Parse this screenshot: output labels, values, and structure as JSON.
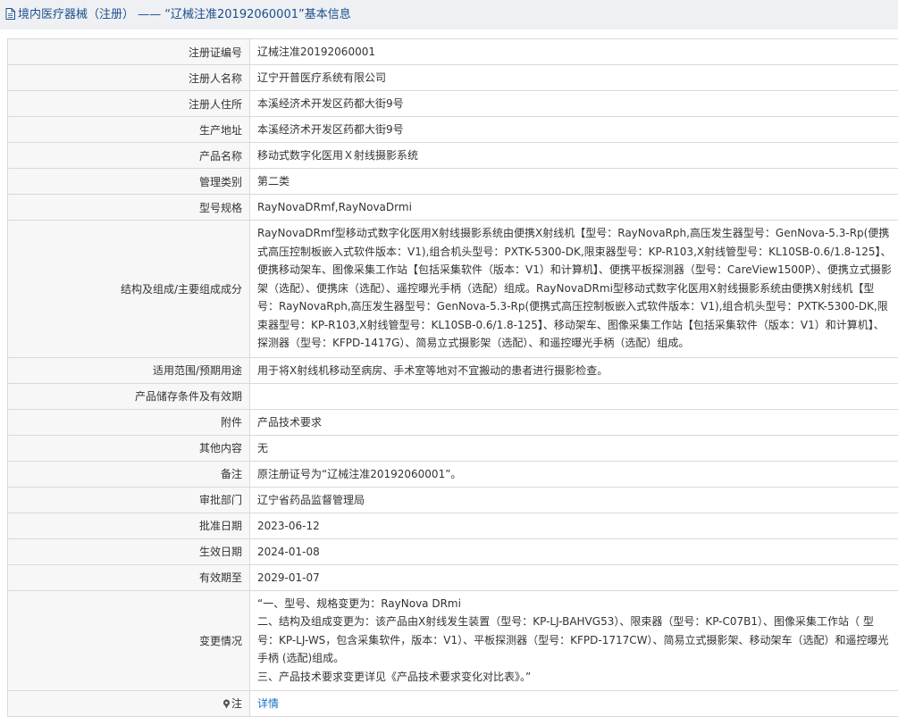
{
  "page": {
    "title": "境内医疗器械（注册） —— “辽械注准20192060001”基本信息"
  },
  "rows": [
    {
      "label": "注册证编号",
      "value": "辽械注准20192060001"
    },
    {
      "label": "注册人名称",
      "value": "辽宁开普医疗系统有限公司"
    },
    {
      "label": "注册人住所",
      "value": "本溪经济术开发区药都大街9号"
    },
    {
      "label": "生产地址",
      "value": "本溪经济术开发区药都大街9号"
    },
    {
      "label": "产品名称",
      "value": "移动式数字化医用Ｘ射线摄影系统"
    },
    {
      "label": "管理类别",
      "value": "第二类"
    },
    {
      "label": "型号规格",
      "value": "RayNovaDRmf,RayNovaDrmi"
    },
    {
      "label": "结构及组成/主要组成成分",
      "value": "RayNovaDRmf型移动式数字化医用X射线摄影系统由便携X射线机【型号：RayNovaRph,高压发生器型号：GenNova-5.3-Rp(便携式高压控制板嵌入式软件版本：V1),组合机头型号：PXTK-5300-DK,限束器型号：KP-R103,X射线管型号：KL10SB-0.6/1.8-125】、便携移动架车、图像采集工作站【包括采集软件（版本：V1）和计算机】、便携平板探测器（型号：CareView1500P）、便携立式摄影架（选配）、便携床（选配）、遥控曝光手柄（选配）组成。RayNovaDRmi型移动式数字化医用X射线摄影系统由便携X射线机【型号：RayNovaRph,高压发生器型号：GenNova-5.3-Rp(便携式高压控制板嵌入式软件版本：V1),组合机头型号：PXTK-5300-DK,限束器型号：KP-R103,X射线管型号：KL10SB-0.6/1.8-125】、移动架车、图像采集工作站【包括采集软件（版本：V1）和计算机】、探测器（型号：KFPD-1417G）、简易立式摄影架（选配）、和遥控曝光手柄（选配）组成。"
    },
    {
      "label": "适用范围/预期用途",
      "value": "用于将X射线机移动至病房、手术室等地对不宜搬动的患者进行摄影检查。"
    },
    {
      "label": "产品储存条件及有效期",
      "value": ""
    },
    {
      "label": "附件",
      "value": "产品技术要求"
    },
    {
      "label": "其他内容",
      "value": "无"
    },
    {
      "label": "备注",
      "value": "原注册证号为“辽械注准20192060001”。"
    },
    {
      "label": "审批部门",
      "value": "辽宁省药品监督管理局"
    },
    {
      "label": "批准日期",
      "value": "2023-06-12"
    },
    {
      "label": "生效日期",
      "value": "2024-01-08"
    },
    {
      "label": "有效期至",
      "value": "2029-01-07"
    }
  ],
  "change": {
    "label": "变更情况",
    "lines": [
      "“一、型号、规格变更为：RayNova DRmi",
      "二、结构及组成变更为：该产品由X射线发生装置（型号：KP-LJ-BAHVG53）、限束器（型号：KP-C07B1）、图像采集工作站（ 型号：KP-LJ-WS，包含采集软件，版本：V1）、平板探测器（型号：KFPD-1717CW）、简易立式摄影架、移动架车（选配）和遥控曝光手柄 (选配)组成。",
      "三、产品技术要求变更详见《产品技术要求变化对比表》。”"
    ]
  },
  "note": {
    "label": "注",
    "link_text": "详情"
  },
  "icons": {
    "title": "document-icon",
    "note": "pin-icon"
  },
  "colors": {
    "title_text": "#1a4f8b",
    "link": "#1a6fc4",
    "label_bg": "#f7f7f7",
    "border": "#d9d9d9"
  }
}
